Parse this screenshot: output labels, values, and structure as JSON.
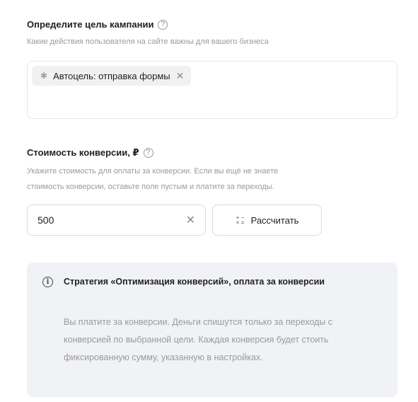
{
  "goal_section": {
    "title": "Определите цель кампании",
    "help_icon": "question-circle-icon",
    "hint": "Какие действия пользователя на сайте важны для вашего бизнеса",
    "selected_goal": {
      "label": "Автоцель: отправка формы",
      "marker": "✱",
      "close": "✕"
    }
  },
  "cost_section": {
    "title": "Стоимость конверсии, ₽",
    "help_icon": "question-circle-icon",
    "hint_line1": "Укажите стоимость для оплаты за конверсии. Если вы ещё не знаете",
    "hint_line2": "стоимость конверсии, оставьте поле пустым и платите за переходы.",
    "input_value": "500",
    "clear": "✕",
    "calculate_label": "Рассчитать",
    "calculate_icon": "calculator-icon"
  },
  "info": {
    "icon": "info-icon",
    "title": "Стратегия «Оптимизация конверсий», оплата за конверсии",
    "text": "Вы платите за конверсии. Деньги спишутся только за переходы с конверсией по выбранной цели. Каждая конверсия будет стоить фиксированную сумму, указанную в настройках."
  }
}
